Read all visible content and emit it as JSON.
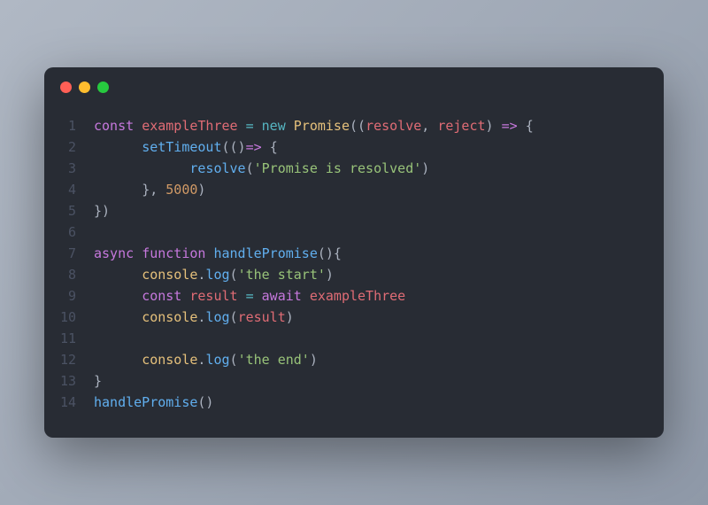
{
  "traffic": {
    "red": "#ff5f56",
    "yellow": "#ffbd2e",
    "green": "#27c93f"
  },
  "gutter": [
    "1",
    "2",
    "3",
    "4",
    "5",
    "6",
    "7",
    "8",
    "9",
    "10",
    "11",
    "12",
    "13",
    "14"
  ],
  "code": {
    "l1": {
      "kw": "const",
      "sp1": " ",
      "var": "exampleThree",
      "sp2": " ",
      "op1": "=",
      "sp3": " ",
      "op2": "new",
      "sp4": " ",
      "cls": "Promise",
      "p1": "((",
      "a1": "resolve",
      "c1": ", ",
      "a2": "reject",
      "p2": ")",
      "sp5": " ",
      "ar": "=>",
      "sp6": " ",
      "p3": "{"
    },
    "l2": {
      "indent": "      ",
      "fn": "setTimeout",
      "p1": "(()",
      "ar": "=>",
      "sp": " ",
      "p2": "{"
    },
    "l3": {
      "indent": "            ",
      "fn": "resolve",
      "p1": "(",
      "str": "'Promise is resolved'",
      "p2": ")"
    },
    "l4": {
      "indent": "      ",
      "p1": "}, ",
      "num": "5000",
      "p2": ")"
    },
    "l5": {
      "text": "})"
    },
    "l6": {
      "text": ""
    },
    "l7": {
      "kw1": "async",
      "sp1": " ",
      "kw2": "function",
      "sp2": " ",
      "fn": "handlePromise",
      "p": "(){"
    },
    "l8": {
      "indent": "      ",
      "obj": "console",
      "dot": ".",
      "fn": "log",
      "p1": "(",
      "str": "'the start'",
      "p2": ")"
    },
    "l9": {
      "indent": "      ",
      "kw1": "const",
      "sp1": " ",
      "var": "result",
      "sp2": " ",
      "op": "=",
      "sp3": " ",
      "kw2": "await",
      "sp4": " ",
      "ref": "exampleThree"
    },
    "l10": {
      "indent": "      ",
      "obj": "console",
      "dot": ".",
      "fn": "log",
      "p1": "(",
      "var": "result",
      "p2": ")"
    },
    "l11": {
      "text": ""
    },
    "l12": {
      "indent": "      ",
      "obj": "console",
      "dot": ".",
      "fn": "log",
      "p1": "(",
      "str": "'the end'",
      "p2": ")"
    },
    "l13": {
      "text": "}"
    },
    "l14": {
      "fn": "handlePromise",
      "p": "()"
    }
  }
}
